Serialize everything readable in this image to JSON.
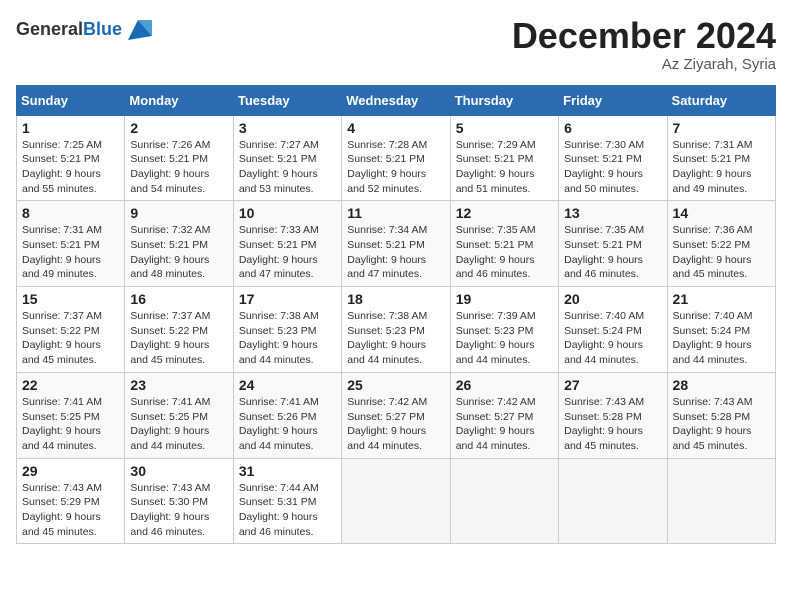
{
  "header": {
    "logo_general": "General",
    "logo_blue": "Blue",
    "month_title": "December 2024",
    "location": "Az Ziyarah, Syria"
  },
  "weekdays": [
    "Sunday",
    "Monday",
    "Tuesday",
    "Wednesday",
    "Thursday",
    "Friday",
    "Saturday"
  ],
  "weeks": [
    [
      {
        "day": "1",
        "sunrise": "Sunrise: 7:25 AM",
        "sunset": "Sunset: 5:21 PM",
        "daylight": "Daylight: 9 hours and 55 minutes."
      },
      {
        "day": "2",
        "sunrise": "Sunrise: 7:26 AM",
        "sunset": "Sunset: 5:21 PM",
        "daylight": "Daylight: 9 hours and 54 minutes."
      },
      {
        "day": "3",
        "sunrise": "Sunrise: 7:27 AM",
        "sunset": "Sunset: 5:21 PM",
        "daylight": "Daylight: 9 hours and 53 minutes."
      },
      {
        "day": "4",
        "sunrise": "Sunrise: 7:28 AM",
        "sunset": "Sunset: 5:21 PM",
        "daylight": "Daylight: 9 hours and 52 minutes."
      },
      {
        "day": "5",
        "sunrise": "Sunrise: 7:29 AM",
        "sunset": "Sunset: 5:21 PM",
        "daylight": "Daylight: 9 hours and 51 minutes."
      },
      {
        "day": "6",
        "sunrise": "Sunrise: 7:30 AM",
        "sunset": "Sunset: 5:21 PM",
        "daylight": "Daylight: 9 hours and 50 minutes."
      },
      {
        "day": "7",
        "sunrise": "Sunrise: 7:31 AM",
        "sunset": "Sunset: 5:21 PM",
        "daylight": "Daylight: 9 hours and 49 minutes."
      }
    ],
    [
      {
        "day": "8",
        "sunrise": "Sunrise: 7:31 AM",
        "sunset": "Sunset: 5:21 PM",
        "daylight": "Daylight: 9 hours and 49 minutes."
      },
      {
        "day": "9",
        "sunrise": "Sunrise: 7:32 AM",
        "sunset": "Sunset: 5:21 PM",
        "daylight": "Daylight: 9 hours and 48 minutes."
      },
      {
        "day": "10",
        "sunrise": "Sunrise: 7:33 AM",
        "sunset": "Sunset: 5:21 PM",
        "daylight": "Daylight: 9 hours and 47 minutes."
      },
      {
        "day": "11",
        "sunrise": "Sunrise: 7:34 AM",
        "sunset": "Sunset: 5:21 PM",
        "daylight": "Daylight: 9 hours and 47 minutes."
      },
      {
        "day": "12",
        "sunrise": "Sunrise: 7:35 AM",
        "sunset": "Sunset: 5:21 PM",
        "daylight": "Daylight: 9 hours and 46 minutes."
      },
      {
        "day": "13",
        "sunrise": "Sunrise: 7:35 AM",
        "sunset": "Sunset: 5:21 PM",
        "daylight": "Daylight: 9 hours and 46 minutes."
      },
      {
        "day": "14",
        "sunrise": "Sunrise: 7:36 AM",
        "sunset": "Sunset: 5:22 PM",
        "daylight": "Daylight: 9 hours and 45 minutes."
      }
    ],
    [
      {
        "day": "15",
        "sunrise": "Sunrise: 7:37 AM",
        "sunset": "Sunset: 5:22 PM",
        "daylight": "Daylight: 9 hours and 45 minutes."
      },
      {
        "day": "16",
        "sunrise": "Sunrise: 7:37 AM",
        "sunset": "Sunset: 5:22 PM",
        "daylight": "Daylight: 9 hours and 45 minutes."
      },
      {
        "day": "17",
        "sunrise": "Sunrise: 7:38 AM",
        "sunset": "Sunset: 5:23 PM",
        "daylight": "Daylight: 9 hours and 44 minutes."
      },
      {
        "day": "18",
        "sunrise": "Sunrise: 7:38 AM",
        "sunset": "Sunset: 5:23 PM",
        "daylight": "Daylight: 9 hours and 44 minutes."
      },
      {
        "day": "19",
        "sunrise": "Sunrise: 7:39 AM",
        "sunset": "Sunset: 5:23 PM",
        "daylight": "Daylight: 9 hours and 44 minutes."
      },
      {
        "day": "20",
        "sunrise": "Sunrise: 7:40 AM",
        "sunset": "Sunset: 5:24 PM",
        "daylight": "Daylight: 9 hours and 44 minutes."
      },
      {
        "day": "21",
        "sunrise": "Sunrise: 7:40 AM",
        "sunset": "Sunset: 5:24 PM",
        "daylight": "Daylight: 9 hours and 44 minutes."
      }
    ],
    [
      {
        "day": "22",
        "sunrise": "Sunrise: 7:41 AM",
        "sunset": "Sunset: 5:25 PM",
        "daylight": "Daylight: 9 hours and 44 minutes."
      },
      {
        "day": "23",
        "sunrise": "Sunrise: 7:41 AM",
        "sunset": "Sunset: 5:25 PM",
        "daylight": "Daylight: 9 hours and 44 minutes."
      },
      {
        "day": "24",
        "sunrise": "Sunrise: 7:41 AM",
        "sunset": "Sunset: 5:26 PM",
        "daylight": "Daylight: 9 hours and 44 minutes."
      },
      {
        "day": "25",
        "sunrise": "Sunrise: 7:42 AM",
        "sunset": "Sunset: 5:27 PM",
        "daylight": "Daylight: 9 hours and 44 minutes."
      },
      {
        "day": "26",
        "sunrise": "Sunrise: 7:42 AM",
        "sunset": "Sunset: 5:27 PM",
        "daylight": "Daylight: 9 hours and 44 minutes."
      },
      {
        "day": "27",
        "sunrise": "Sunrise: 7:43 AM",
        "sunset": "Sunset: 5:28 PM",
        "daylight": "Daylight: 9 hours and 45 minutes."
      },
      {
        "day": "28",
        "sunrise": "Sunrise: 7:43 AM",
        "sunset": "Sunset: 5:28 PM",
        "daylight": "Daylight: 9 hours and 45 minutes."
      }
    ],
    [
      {
        "day": "29",
        "sunrise": "Sunrise: 7:43 AM",
        "sunset": "Sunset: 5:29 PM",
        "daylight": "Daylight: 9 hours and 45 minutes."
      },
      {
        "day": "30",
        "sunrise": "Sunrise: 7:43 AM",
        "sunset": "Sunset: 5:30 PM",
        "daylight": "Daylight: 9 hours and 46 minutes."
      },
      {
        "day": "31",
        "sunrise": "Sunrise: 7:44 AM",
        "sunset": "Sunset: 5:31 PM",
        "daylight": "Daylight: 9 hours and 46 minutes."
      },
      null,
      null,
      null,
      null
    ]
  ]
}
